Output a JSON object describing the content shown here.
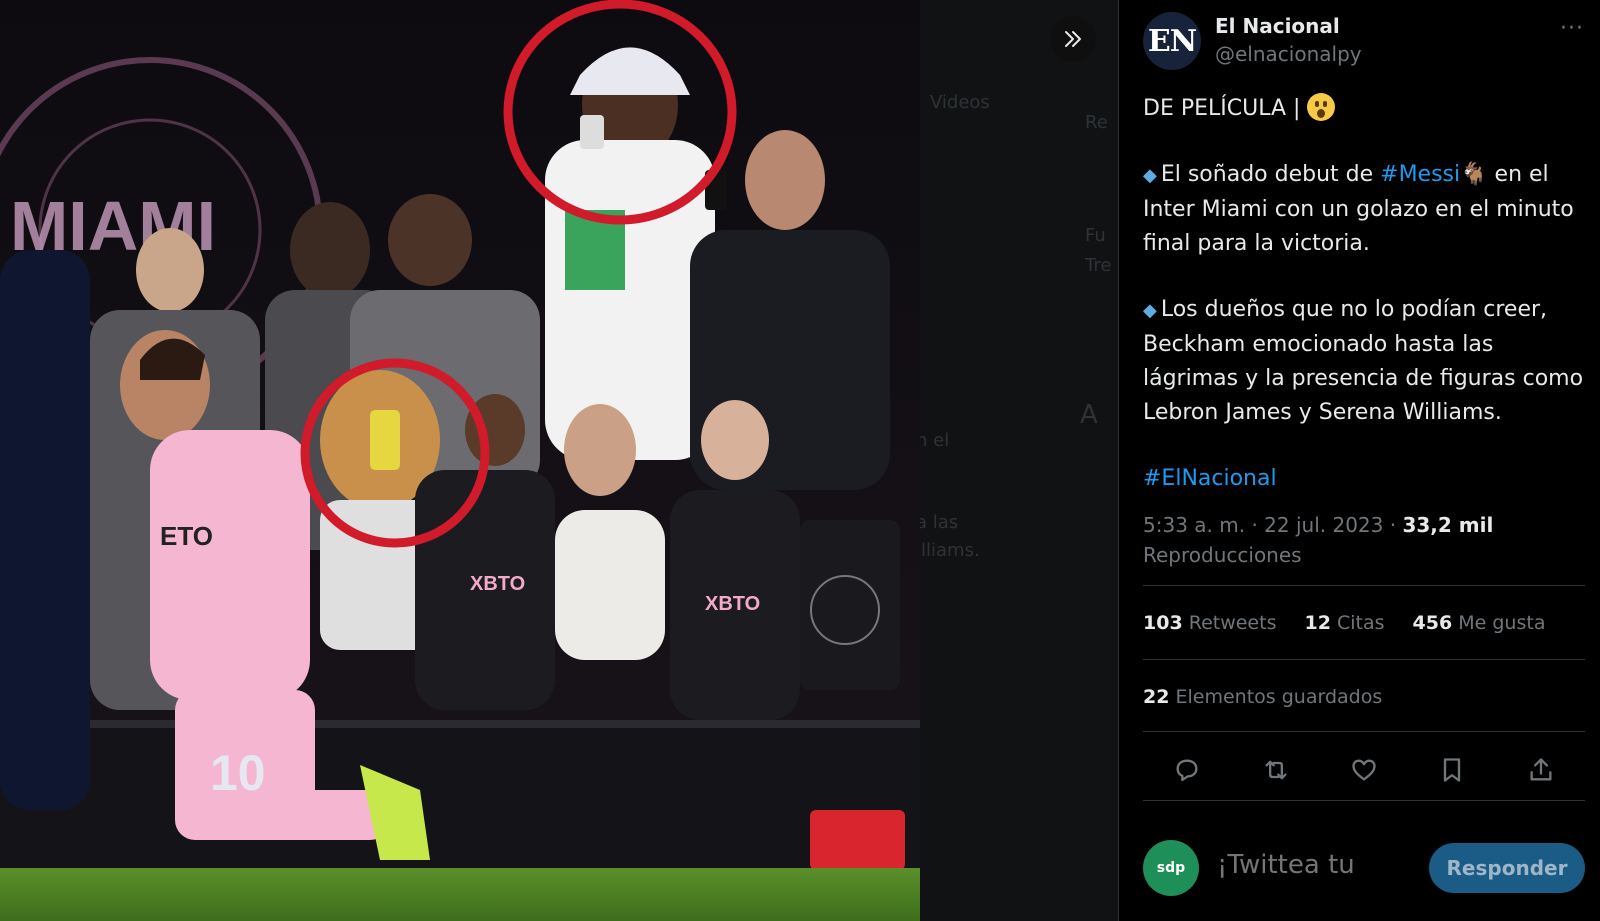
{
  "media": {
    "ghost_texts": [
      "Videos",
      "n el",
      "a las",
      "illiams.",
      "Fu",
      "Re",
      "Tre",
      "A"
    ]
  },
  "tweet": {
    "author_name": "El Nacional",
    "author_handle": "@elnacionalpy",
    "avatar_text": "EN",
    "line_title": "DE PELÍCULA |",
    "p1_a": "El soñado debut de ",
    "p1_tag": "#Messi",
    "p1_b": " en el Inter Miami con un golazo en el minuto final para la victoria.",
    "p2": "Los dueños que no lo podían creer, Beckham emocionado hasta las lágrimas y la presencia de figuras como Lebron James y Serena Williams.",
    "hashtag": "#ElNacional",
    "time": "5:33 a. m. · 22 jul. 2023 · ",
    "views_count": "33,2 mil",
    "views_label": "Reproducciones"
  },
  "stats": {
    "retweets_count": "103",
    "retweets_label": "Retweets",
    "quotes_count": "12",
    "quotes_label": "Citas",
    "likes_count": "456",
    "likes_label": "Me gusta",
    "saved_count": "22",
    "saved_label": "Elementos guardados"
  },
  "reply": {
    "placeholder": "¡Twittea tu",
    "button_label": "Responder",
    "avatar_text": "sdp"
  },
  "icons": [
    "double-chevron-right-icon",
    "more-icon",
    "reply-icon",
    "retweet-icon",
    "like-icon",
    "bookmark-icon",
    "share-icon"
  ],
  "colors": {
    "link": "#1d9bf0",
    "muted": "#71767b",
    "reply_button": "#1a5c86",
    "highlight_circle": "#d11a2a"
  }
}
